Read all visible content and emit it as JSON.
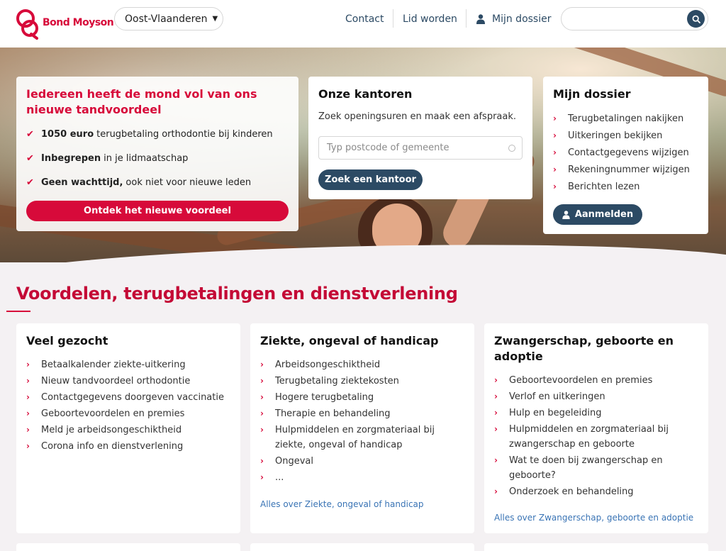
{
  "header": {
    "logo_text": "Bond Moyson",
    "region": "Oost-Vlaanderen",
    "nav": {
      "contact": "Contact",
      "lid_worden": "Lid worden",
      "mijn_dossier": "Mijn dossier"
    },
    "search_placeholder": ""
  },
  "promo": {
    "title": "Iedereen heeft de mond vol van ons nieuwe tandvoordeel",
    "items": [
      {
        "bold": "1050 euro",
        "rest": "terugbetaling orthodontie bij kinderen"
      },
      {
        "bold": "Inbegrepen",
        "rest": "in je lidmaatschap"
      },
      {
        "bold": "Geen wachttijd,",
        "rest": "ook niet voor nieuwe leden"
      }
    ],
    "button": "Ontdek het nieuwe voordeel"
  },
  "kantoren": {
    "title": "Onze kantoren",
    "subtitle": "Zoek openingsuren en maak een afspraak.",
    "placeholder": "Typ postcode of gemeente",
    "button": "Zoek een kantoor"
  },
  "dossier": {
    "title": "Mijn dossier",
    "items": [
      "Terugbetalingen nakijken",
      "Uitkeringen bekijken",
      "Contactgegevens wijzigen",
      "Rekeningnummer wijzigen",
      "Berichten lezen"
    ],
    "button": "Aanmelden"
  },
  "section": {
    "title": "Voordelen, terugbetalingen en dienstverlening"
  },
  "tiles": [
    {
      "title": "Veel gezocht",
      "items": [
        "Betaalkalender ziekte-uitkering",
        "Nieuw tandvoordeel orthodontie",
        "Contactgegevens doorgeven vaccinatie",
        "Geboortevoordelen en premies",
        "Meld je arbeidsongeschiktheid",
        "Corona info en dienstverlening"
      ],
      "link": ""
    },
    {
      "title": "Ziekte, ongeval of handicap",
      "items": [
        "Arbeidsongeschiktheid",
        "Terugbetaling ziektekosten",
        "Hogere terugbetaling",
        "Therapie en behandeling",
        "Hulpmiddelen en zorgmateriaal bij ziekte, ongeval of handicap",
        "Ongeval",
        "..."
      ],
      "link": "Alles over Ziekte, ongeval of handicap"
    },
    {
      "title": "Zwangerschap, geboorte en adoptie",
      "items": [
        "Geboortevoordelen en premies",
        "Verlof en uitkeringen",
        "Hulp en begeleiding",
        "Hulpmiddelen en zorgmateriaal bij zwangerschap en geboorte",
        "Wat te doen bij zwangerschap en geboorte?",
        "Onderzoek en behandeling"
      ],
      "link": "Alles over Zwangerschap, geboorte en adoptie"
    }
  ],
  "colors": {
    "brand_red": "#d70a3a",
    "navy": "#2c4a64",
    "link_blue": "#3a74b5"
  }
}
